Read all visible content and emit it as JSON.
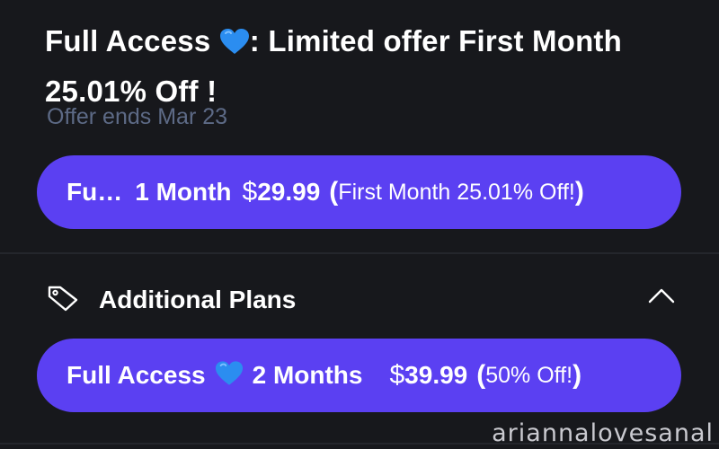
{
  "offer": {
    "title_part1": "Full Access",
    "title_part2": ": Limited offer First Month 25.01% Off !",
    "subtitle": "Offer ends Mar 23"
  },
  "primary_plan": {
    "name": "Fu…",
    "duration": "1 Month",
    "currency_symbol": "$",
    "price": "29.99",
    "paren_open": "(",
    "note": "First Month 25.01% Off!",
    "paren_close": ")"
  },
  "additional_plans": {
    "label": "Additional Plans",
    "tag_icon": "tag-icon",
    "toggle_icon": "chevron-up-icon"
  },
  "plans": [
    {
      "name": "Full Access",
      "duration": "2 Months",
      "currency_symbol": "$",
      "price": "39.99",
      "paren_open": "(",
      "note": "50% Off!",
      "paren_close": ")"
    }
  ],
  "watermark": "ariannalovesanal",
  "colors": {
    "background": "#17181c",
    "accent": "#5b40f2",
    "subtitle": "#5d6a86",
    "heart": "#2b8df0"
  }
}
